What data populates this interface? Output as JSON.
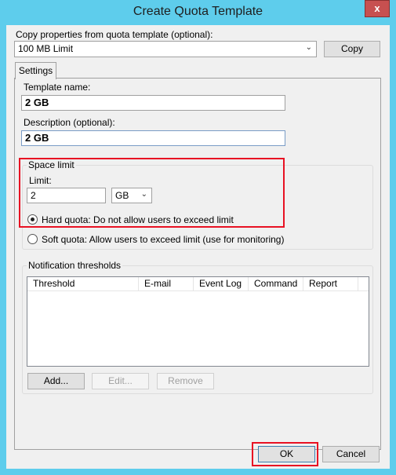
{
  "window": {
    "title": "Create Quota Template",
    "close_label": "x"
  },
  "copy_from": {
    "label": "Copy properties from quota template (optional):",
    "selected": "100 MB Limit",
    "copy_button": "Copy"
  },
  "tabs": [
    {
      "label": "Settings",
      "active": true
    }
  ],
  "template_name": {
    "label": "Template name:",
    "value": "2 GB"
  },
  "description": {
    "label": "Description (optional):",
    "value": "2 GB"
  },
  "space_limit": {
    "legend": "Space limit",
    "limit_label": "Limit:",
    "limit_value": "2",
    "unit": "GB",
    "hard_quota": {
      "label": "Hard quota: Do not allow users to exceed limit",
      "checked": true
    },
    "soft_quota": {
      "label": "Soft quota: Allow users to exceed limit (use for monitoring)",
      "checked": false
    }
  },
  "notifications": {
    "legend": "Notification thresholds",
    "columns": [
      "Threshold",
      "E-mail",
      "Event Log",
      "Command",
      "Report"
    ],
    "rows": [],
    "add": "Add...",
    "edit": "Edit...",
    "remove": "Remove"
  },
  "footer": {
    "ok": "OK",
    "cancel": "Cancel"
  },
  "colors": {
    "frame": "#5ecdec",
    "highlight": "#e81123",
    "close": "#c75050"
  }
}
